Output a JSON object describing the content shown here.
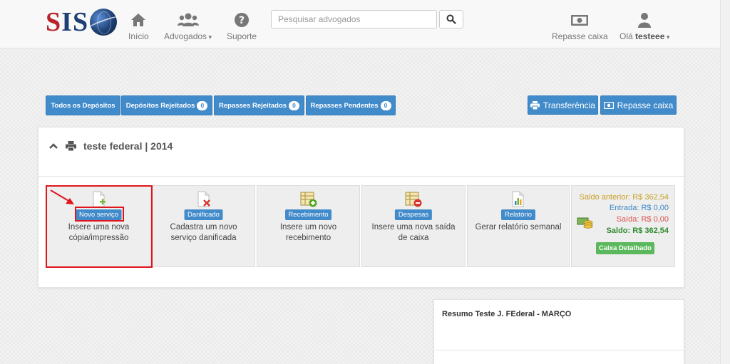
{
  "navbar": {
    "logo_text_s1": "S",
    "logo_text_i": "I",
    "logo_text_s2": "S",
    "items": [
      {
        "label": "Início",
        "icon": "home-icon"
      },
      {
        "label": "Advogados",
        "icon": "users-icon"
      },
      {
        "label": "Suporte",
        "icon": "question-icon"
      }
    ],
    "search": {
      "placeholder": "Pesquisar advogados",
      "value": ""
    },
    "repasse_label": "Repasse caixa",
    "user_greeting": "Olá",
    "user_name": "testeee"
  },
  "toolbar": {
    "tabs": [
      {
        "label": "Todos os Depósitos",
        "badge": null
      },
      {
        "label": "Depósitos Rejeitados",
        "badge": "0"
      },
      {
        "label": "Repasses Rejeitados",
        "badge": "0"
      },
      {
        "label": "Repasses Pendentes",
        "badge": "0"
      }
    ],
    "transferencia_label": "Transferência",
    "repasse_caixa_label": "Repasse caixa"
  },
  "panel": {
    "title": "teste federal | 2014",
    "tiles": [
      {
        "tag": "Novo serviço",
        "desc": "Insere uma nova cópia/impressão",
        "icon": "new-doc-icon"
      },
      {
        "tag": "Danificado",
        "desc": "Cadastra um novo serviço danificada",
        "icon": "damaged-doc-icon"
      },
      {
        "tag": "Recebimento",
        "desc": "Insere um novo recebimento",
        "icon": "income-icon"
      },
      {
        "tag": "Despesas",
        "desc": "Insere uma nova saída de caixa",
        "icon": "expense-icon"
      },
      {
        "tag": "Relatório",
        "desc": "Gerar relatório semanal",
        "icon": "report-icon"
      }
    ],
    "summary": {
      "saldo_anterior": "Saldo anterior: R$ 362,54",
      "entrada": "Entrada: R$ 0,00",
      "saida": "Saída: R$ 0,00",
      "saldo": "Saldo: R$ 362,54",
      "caixa_btn": "Caixa Detalhado"
    },
    "colors": {
      "saldo_anterior": "#c9a227",
      "entrada": "#3a87c8",
      "saida": "#d9534f",
      "saldo": "#2e8b2e"
    }
  },
  "resumo": {
    "title": "Resumo Teste J. FEderal - MARÇO"
  },
  "colors": {
    "primary": "#428bca",
    "success": "#5cb85c",
    "annotation": "#e0161c"
  }
}
